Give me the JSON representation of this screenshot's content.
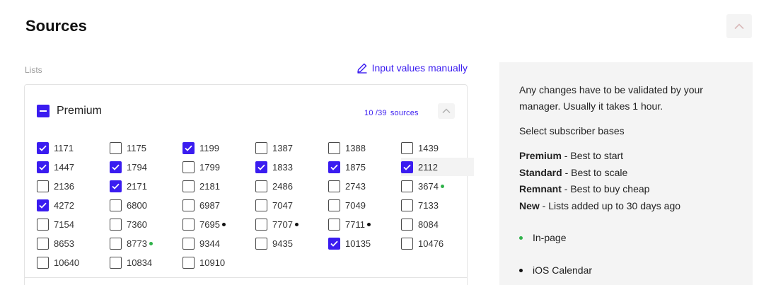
{
  "header": {
    "title": "Sources"
  },
  "lists": {
    "label": "Lists",
    "manual_link": "Input values manually"
  },
  "group": {
    "name": "Premium",
    "selected": "10",
    "total": "/39",
    "sources_word": "sources",
    "items": [
      {
        "label": "1171",
        "checked": true,
        "dot": ""
      },
      {
        "label": "1175",
        "checked": false,
        "dot": ""
      },
      {
        "label": "1199",
        "checked": true,
        "dot": ""
      },
      {
        "label": "1387",
        "checked": false,
        "dot": ""
      },
      {
        "label": "1388",
        "checked": false,
        "dot": ""
      },
      {
        "label": "1439",
        "checked": false,
        "dot": ""
      },
      {
        "label": "1447",
        "checked": true,
        "dot": ""
      },
      {
        "label": "1794",
        "checked": true,
        "dot": ""
      },
      {
        "label": "1799",
        "checked": false,
        "dot": ""
      },
      {
        "label": "1833",
        "checked": true,
        "dot": ""
      },
      {
        "label": "1875",
        "checked": true,
        "dot": ""
      },
      {
        "label": "2112",
        "checked": true,
        "dot": "",
        "highlight": true
      },
      {
        "label": "2136",
        "checked": false,
        "dot": ""
      },
      {
        "label": "2171",
        "checked": true,
        "dot": ""
      },
      {
        "label": "2181",
        "checked": false,
        "dot": ""
      },
      {
        "label": "2486",
        "checked": false,
        "dot": ""
      },
      {
        "label": "2743",
        "checked": false,
        "dot": ""
      },
      {
        "label": "3674",
        "checked": false,
        "dot": "green"
      },
      {
        "label": "4272",
        "checked": true,
        "dot": ""
      },
      {
        "label": "6800",
        "checked": false,
        "dot": ""
      },
      {
        "label": "6987",
        "checked": false,
        "dot": ""
      },
      {
        "label": "7047",
        "checked": false,
        "dot": ""
      },
      {
        "label": "7049",
        "checked": false,
        "dot": ""
      },
      {
        "label": "7133",
        "checked": false,
        "dot": ""
      },
      {
        "label": "7154",
        "checked": false,
        "dot": ""
      },
      {
        "label": "7360",
        "checked": false,
        "dot": ""
      },
      {
        "label": "7695",
        "checked": false,
        "dot": "black"
      },
      {
        "label": "7707",
        "checked": false,
        "dot": "black"
      },
      {
        "label": "7711",
        "checked": false,
        "dot": "black"
      },
      {
        "label": "8084",
        "checked": false,
        "dot": ""
      },
      {
        "label": "8653",
        "checked": false,
        "dot": ""
      },
      {
        "label": "8773",
        "checked": false,
        "dot": "green"
      },
      {
        "label": "9344",
        "checked": false,
        "dot": ""
      },
      {
        "label": "9435",
        "checked": false,
        "dot": ""
      },
      {
        "label": "10135",
        "checked": true,
        "dot": ""
      },
      {
        "label": "10476",
        "checked": false,
        "dot": ""
      },
      {
        "label": "10640",
        "checked": false,
        "dot": ""
      },
      {
        "label": "10834",
        "checked": false,
        "dot": ""
      },
      {
        "label": "10910",
        "checked": false,
        "dot": ""
      }
    ]
  },
  "panel": {
    "note": "Any changes have to be validated by your manager. Usually it takes 1 hour.",
    "select": "Select subscriber bases",
    "bases": [
      {
        "name": "Premium",
        "desc": " - Best to start"
      },
      {
        "name": "Standard",
        "desc": " - Best to scale"
      },
      {
        "name": "Remnant",
        "desc": " - Best to buy cheap"
      },
      {
        "name": "New",
        "desc": " - Lists added up to 30 days ago"
      }
    ],
    "legend": [
      {
        "label": "In-page",
        "color": "#2fb24a"
      },
      {
        "label": "iOS Calendar",
        "color": "#111111"
      }
    ]
  },
  "colors": {
    "accent": "#3a1cf0",
    "green_dot": "#2fb24a",
    "black_dot": "#111111"
  },
  "icons": {
    "edit": "pencil-icon",
    "collapse": "chevron-up-icon",
    "check": "check-icon"
  }
}
